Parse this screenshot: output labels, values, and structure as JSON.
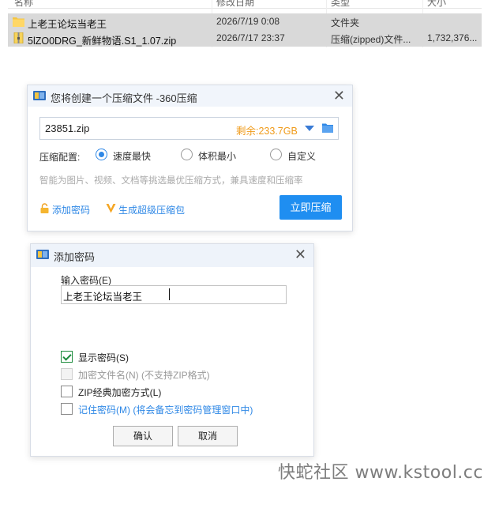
{
  "file_list": {
    "headers": [
      "名称",
      "修改日期",
      "类型",
      "大小"
    ],
    "rows": [
      {
        "icon": "folder-icon",
        "name": "上老王论坛当老王",
        "date": "2026/7/19 0:08",
        "type": "文件夹",
        "size": ""
      },
      {
        "icon": "zip-file-icon",
        "name": "5lZO0DRG_新鲜物语.S1_1.07.zip",
        "date": "2026/7/17 23:37",
        "type": "压缩(zipped)文件...",
        "size": "1,732,376..."
      }
    ]
  },
  "compress_dialog": {
    "title": "您将创建一个压缩文件 -360压缩",
    "filename": "23851.zip",
    "free_space": "剩余:233.7GB",
    "config_label": "压缩配置:",
    "options": [
      {
        "label": "速度最快",
        "selected": true
      },
      {
        "label": "体积最小",
        "selected": false
      },
      {
        "label": "自定义",
        "selected": false
      }
    ],
    "hint": "智能为图片、视频、文档等挑选最优压缩方式，兼具速度和压缩率",
    "add_password_label": "添加密码",
    "super_compress_label": "生成超级压缩包",
    "compress_button": "立即压缩",
    "accent_color": "#1f8ef1"
  },
  "password_dialog": {
    "title": "添加密码",
    "input_label": "输入密码(E)",
    "password_value": "上老王论坛当老王",
    "checkboxes": [
      {
        "label": "显示密码(S)",
        "checked": true,
        "disabled": false
      },
      {
        "label": "加密文件名(N) (不支持ZIP格式)",
        "checked": false,
        "disabled": true
      },
      {
        "label": "ZIP经典加密方式(L)",
        "checked": false,
        "disabled": false
      },
      {
        "label": "记住密码(M) (将会备忘到密码管理窗口中)",
        "checked": false,
        "disabled": false
      }
    ],
    "ok_button": "确认",
    "cancel_button": "取消"
  },
  "watermark": "快蛇社区 www.kstool.cc"
}
